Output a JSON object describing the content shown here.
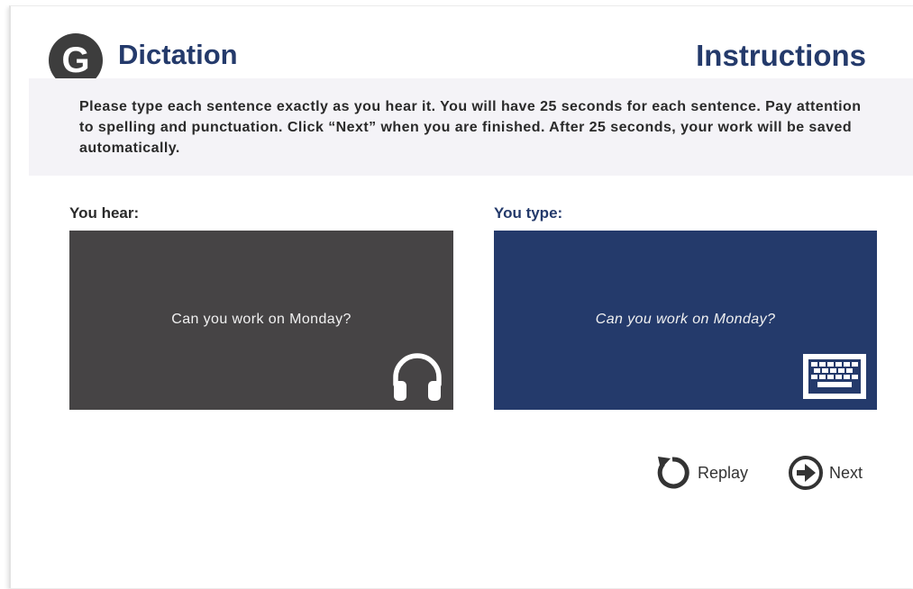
{
  "header": {
    "badge_letter": "G",
    "title": "Dictation",
    "instructions_title": "Instructions"
  },
  "instructions": {
    "text": "Please type each sentence exactly as you hear it. You will have 25 seconds for each sentence. Pay attention to spelling and punctuation. Click “Next” when you are finished. After 25 seconds, your work will be saved automatically."
  },
  "hear": {
    "label": "You hear:",
    "sentence": "Can you work on Monday?",
    "icon": "headphones-icon"
  },
  "type": {
    "label": "You type:",
    "sentence": "Can you work on Monday?",
    "icon": "keyboard-icon"
  },
  "controls": {
    "replay_label": "Replay",
    "replay_icon": "replay-icon",
    "next_label": "Next",
    "next_icon": "arrow-right-circle-icon"
  },
  "colors": {
    "brand_navy": "#243a6b",
    "hear_panel": "#464445",
    "badge": "#3d3d3d",
    "band": "#f4f3f7"
  }
}
